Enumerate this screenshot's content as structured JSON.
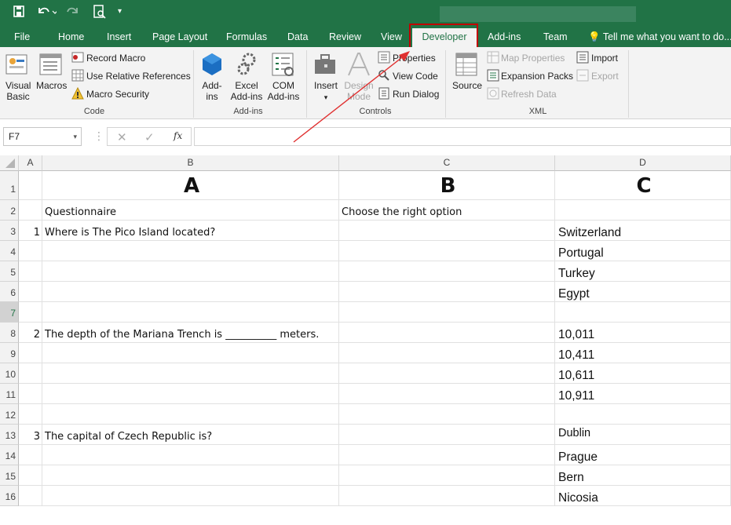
{
  "tabs": [
    "File",
    "Home",
    "Insert",
    "Page Layout",
    "Formulas",
    "Data",
    "Review",
    "View",
    "Developer",
    "Add-ins",
    "Team"
  ],
  "tell_me": "Tell me what you want to do...",
  "ribbon": {
    "visual_basic": [
      "Visual",
      "Basic"
    ],
    "macros": "Macros",
    "record_macro": "Record Macro",
    "relative_refs": "Use Relative References",
    "macro_security": "Macro Security",
    "group_code": "Code",
    "addins": [
      "Add-",
      "ins"
    ],
    "excel_addins": [
      "Excel",
      "Add-ins"
    ],
    "com_addins": [
      "COM",
      "Add-ins"
    ],
    "group_addins": "Add-ins",
    "insert": "Insert",
    "design_mode": [
      "Design",
      "Mode"
    ],
    "properties": "Properties",
    "view_code": "View Code",
    "run_dialog": "Run Dialog",
    "group_controls": "Controls",
    "source": "Source",
    "map_properties": "Map Properties",
    "expansion_packs": "Expansion Packs",
    "refresh_data": "Refresh Data",
    "import": "Import",
    "export": "Export",
    "group_xml": "XML"
  },
  "name_box": "F7",
  "fx": "fx",
  "columns": [
    "A",
    "B",
    "C",
    "D"
  ],
  "rows": [
    {
      "n": "1",
      "a": "",
      "b": "A",
      "c": "B",
      "d": "C"
    },
    {
      "n": "2",
      "a": "",
      "b": "Questionnaire",
      "c": "Choose the right option",
      "d": ""
    },
    {
      "n": "3",
      "a": "1",
      "b": "Where is The Pico Island located?",
      "c": "",
      "d": "Switzerland"
    },
    {
      "n": "4",
      "a": "",
      "b": "",
      "c": "",
      "d": "Portugal"
    },
    {
      "n": "5",
      "a": "",
      "b": "",
      "c": "",
      "d": "Turkey"
    },
    {
      "n": "6",
      "a": "",
      "b": "",
      "c": "",
      "d": "Egypt"
    },
    {
      "n": "7",
      "a": "",
      "b": "",
      "c": "",
      "d": ""
    },
    {
      "n": "8",
      "a": "2",
      "b": "The depth of the Mariana Trench is __________ meters.",
      "c": "",
      "d": "10,011"
    },
    {
      "n": "9",
      "a": "",
      "b": "",
      "c": "",
      "d": "10,411"
    },
    {
      "n": "10",
      "a": "",
      "b": "",
      "c": "",
      "d": "10,611"
    },
    {
      "n": "11",
      "a": "",
      "b": "",
      "c": "",
      "d": "10,911"
    },
    {
      "n": "12",
      "a": "",
      "b": "",
      "c": "",
      "d": ""
    },
    {
      "n": "13",
      "a": "3",
      "b": "The capital of Czech Republic is?",
      "c": "",
      "d": "Dublin"
    },
    {
      "n": "14",
      "a": "",
      "b": "",
      "c": "",
      "d": "Prague"
    },
    {
      "n": "15",
      "a": "",
      "b": "",
      "c": "",
      "d": "Bern"
    },
    {
      "n": "16",
      "a": "",
      "b": "",
      "c": "",
      "d": "Nicosia"
    }
  ],
  "colors": {
    "brand": "#217346",
    "highlight": "#c00000",
    "arrow": "#e03030"
  }
}
